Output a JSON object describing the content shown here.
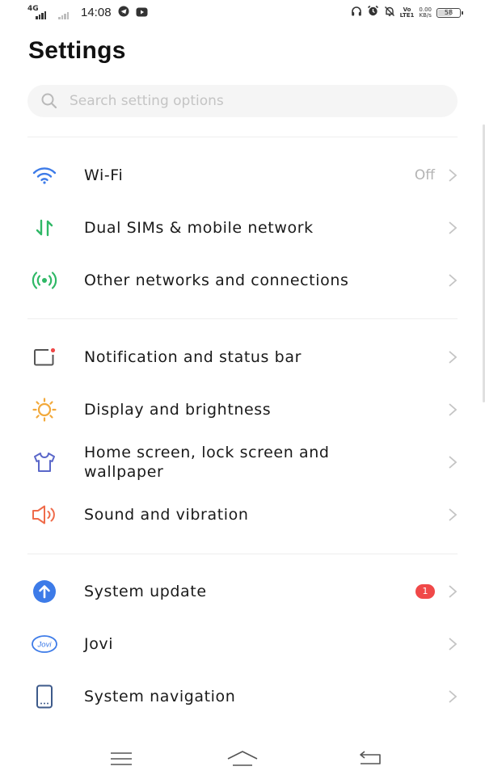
{
  "status_bar": {
    "network_label": "4G",
    "time": "14:08",
    "volte_line1": "Vo",
    "volte_line2": "LTE1",
    "speed_value": "0.00",
    "speed_unit": "KB/s",
    "battery": "58",
    "left_icons": [
      "telegram-icon",
      "youtube-icon"
    ],
    "right_icons": [
      "headphones-icon",
      "alarm-icon",
      "mute-icon"
    ]
  },
  "title": "Settings",
  "search": {
    "placeholder": "Search setting options",
    "value": ""
  },
  "sections": [
    {
      "items": [
        {
          "label": "Wi-Fi",
          "icon": "wifi-icon",
          "value": "Off",
          "icon_color": "#3d7be8"
        },
        {
          "label": "Dual SIMs & mobile network",
          "icon": "mobile-network-icon",
          "icon_color": "#2fb866"
        },
        {
          "label": "Other networks and connections",
          "icon": "connections-icon",
          "icon_color": "#2fb866"
        }
      ]
    },
    {
      "items": [
        {
          "label": "Notification and status bar",
          "icon": "notification-icon",
          "icon_color": "#555555",
          "accent": "#f04848"
        },
        {
          "label": "Display and brightness",
          "icon": "brightness-icon",
          "icon_color": "#f2a93b"
        },
        {
          "label": "Home screen, lock screen and wallpaper",
          "icon": "wallpaper-icon",
          "icon_color": "#5a67c9"
        },
        {
          "label": "Sound and vibration",
          "icon": "sound-icon",
          "icon_color": "#ef6b4a"
        }
      ]
    },
    {
      "items": [
        {
          "label": "System update",
          "icon": "system-update-icon",
          "badge": "1",
          "icon_color": "#3d7be8"
        },
        {
          "label": "Jovi",
          "icon": "jovi-icon",
          "icon_text": "Jovi",
          "icon_color": "#3d7be8"
        },
        {
          "label": "System navigation",
          "icon": "system-navigation-icon",
          "icon_color": "#3d5a8a"
        }
      ]
    }
  ],
  "nav_bar": {
    "buttons": [
      "menu-icon",
      "home-icon",
      "back-icon"
    ]
  }
}
